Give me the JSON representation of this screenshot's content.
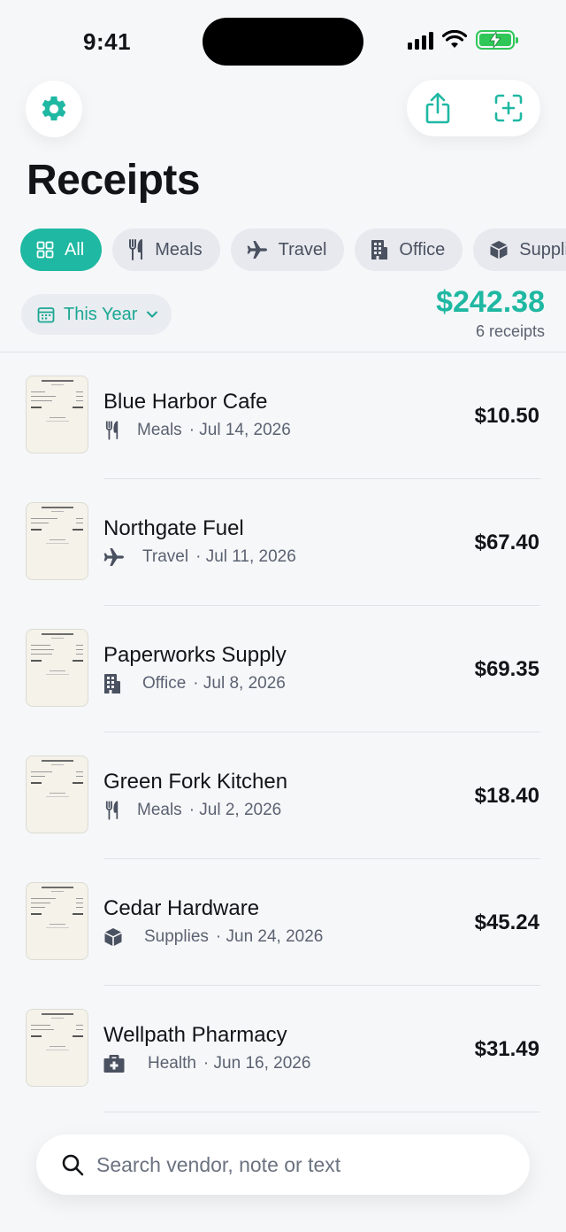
{
  "status_bar": {
    "time": "9:41"
  },
  "header": {
    "title": "Receipts"
  },
  "filters": {
    "categories": [
      {
        "label": "All",
        "icon": "grid-icon",
        "active": true
      },
      {
        "label": "Meals",
        "icon": "utensils-icon",
        "active": false
      },
      {
        "label": "Travel",
        "icon": "airplane-icon",
        "active": false
      },
      {
        "label": "Office",
        "icon": "building-icon",
        "active": false
      },
      {
        "label": "Suppli",
        "icon": "box-icon",
        "active": false
      }
    ],
    "period": "This Year"
  },
  "summary": {
    "total": "$242.38",
    "count": "6 receipts"
  },
  "receipts": [
    {
      "vendor": "Blue Harbor Cafe",
      "category": "Meals",
      "date": "· Jul 14, 2026",
      "amount": "$10.50",
      "icon": "utensils-icon"
    },
    {
      "vendor": "Northgate Fuel",
      "category": "Travel",
      "date": "· Jul 11, 2026",
      "amount": "$67.40",
      "icon": "airplane-icon"
    },
    {
      "vendor": "Paperworks Supply",
      "category": "Office",
      "date": "· Jul 8, 2026",
      "amount": "$69.35",
      "icon": "building-icon"
    },
    {
      "vendor": "Green Fork Kitchen",
      "category": "Meals",
      "date": "· Jul 2, 2026",
      "amount": "$18.40",
      "icon": "utensils-icon"
    },
    {
      "vendor": "Cedar Hardware",
      "category": "Supplies",
      "date": "· Jun 24, 2026",
      "amount": "$45.24",
      "icon": "box-icon"
    },
    {
      "vendor": "Wellpath Pharmacy",
      "category": "Health",
      "date": "· Jun 16, 2026",
      "amount": "$31.49",
      "icon": "medkit-icon"
    }
  ],
  "search": {
    "placeholder": "Search vendor, note or text"
  },
  "colors": {
    "accent": "#1fb8a2",
    "background": "#f6f7f9",
    "battery": "#30c759"
  }
}
